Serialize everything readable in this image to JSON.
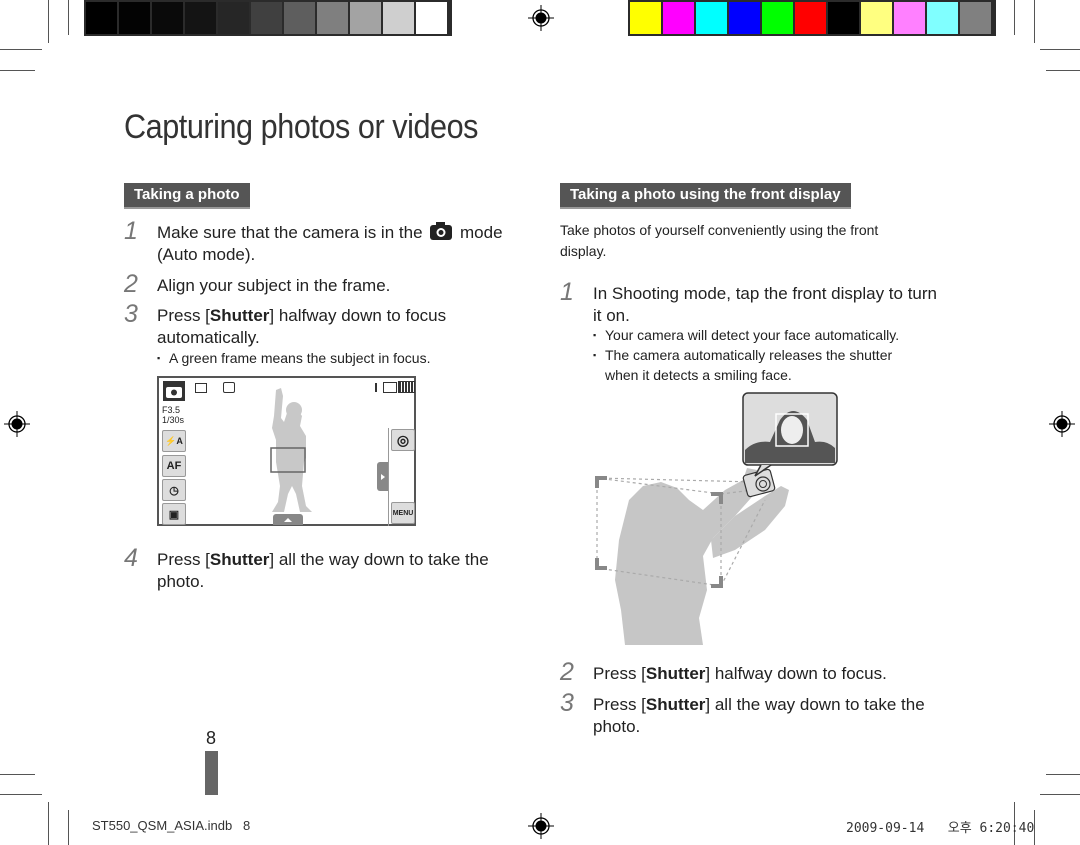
{
  "document": {
    "title": "Capturing photos or videos",
    "left_section": {
      "heading": "Taking a photo",
      "steps": [
        {
          "num": "1",
          "line1": "Make sure that the camera is in the",
          "line1_tail": "mode",
          "line2": "(Auto mode).",
          "icon": "camera-icon"
        },
        {
          "num": "2",
          "text": "Align your subject in the frame."
        },
        {
          "num": "3",
          "pre": "Press [",
          "bold": "Shutter",
          "post": "] halfway down to focus",
          "line2": "automatically.",
          "bullets": [
            "A green frame means the subject in focus."
          ]
        },
        {
          "num": "4",
          "pre": "Press [",
          "bold": "Shutter",
          "post": "] all the way down to take the",
          "line2": "photo."
        }
      ],
      "lcd": {
        "aperture": "F3.5",
        "shutter_speed": "1/30s",
        "left_buttons": [
          {
            "icon": "flash-auto-icon",
            "label": "⚡A"
          },
          {
            "icon": "autofocus-icon",
            "label": "AF"
          },
          {
            "icon": "timer-off-icon",
            "label": "◷"
          },
          {
            "icon": "display-settings-icon",
            "label": "▣"
          }
        ],
        "right_buttons": [
          {
            "icon": "mode-dial-icon",
            "label": "◎"
          },
          {
            "icon": "menu-icon",
            "label": "MENU"
          }
        ]
      }
    },
    "right_section": {
      "heading": "Taking a photo using the front display",
      "intro_line1": "Take photos of yourself conveniently using the front",
      "intro_line2": "display.",
      "steps": [
        {
          "num": "1",
          "text": "In Shooting mode, tap the front display to turn",
          "line2": "it on.",
          "bullets": [
            "Your camera will detect your face automatically.",
            "The camera automatically releases the shutter",
            "when it detects a smiling face."
          ]
        },
        {
          "num": "2",
          "pre": "Press [",
          "bold": "Shutter",
          "post": "] halfway down to focus."
        },
        {
          "num": "3",
          "pre": "Press [",
          "bold": "Shutter",
          "post": "] all the way down to take the",
          "line2": "photo."
        }
      ]
    },
    "page_number": "8",
    "footer": {
      "file": "ST550_QSM_ASIA.indb   8",
      "timestamp": "2009-09-14   오후 6:20:40"
    }
  },
  "print_marks": {
    "gray_swatches": [
      "#000000",
      "#030303",
      "#0a0a0a",
      "#141414",
      "#262626",
      "#404040",
      "#5e5e5e",
      "#7f7f7f",
      "#a3a3a3",
      "#cfcfcf",
      "#ffffff"
    ],
    "color_swatches": [
      "#ffff00",
      "#ff00ff",
      "#00ffff",
      "#0000ff",
      "#00ff00",
      "#ff0000",
      "#000000",
      "#ffff80",
      "#ff80ff",
      "#80ffff",
      "#808080"
    ]
  }
}
